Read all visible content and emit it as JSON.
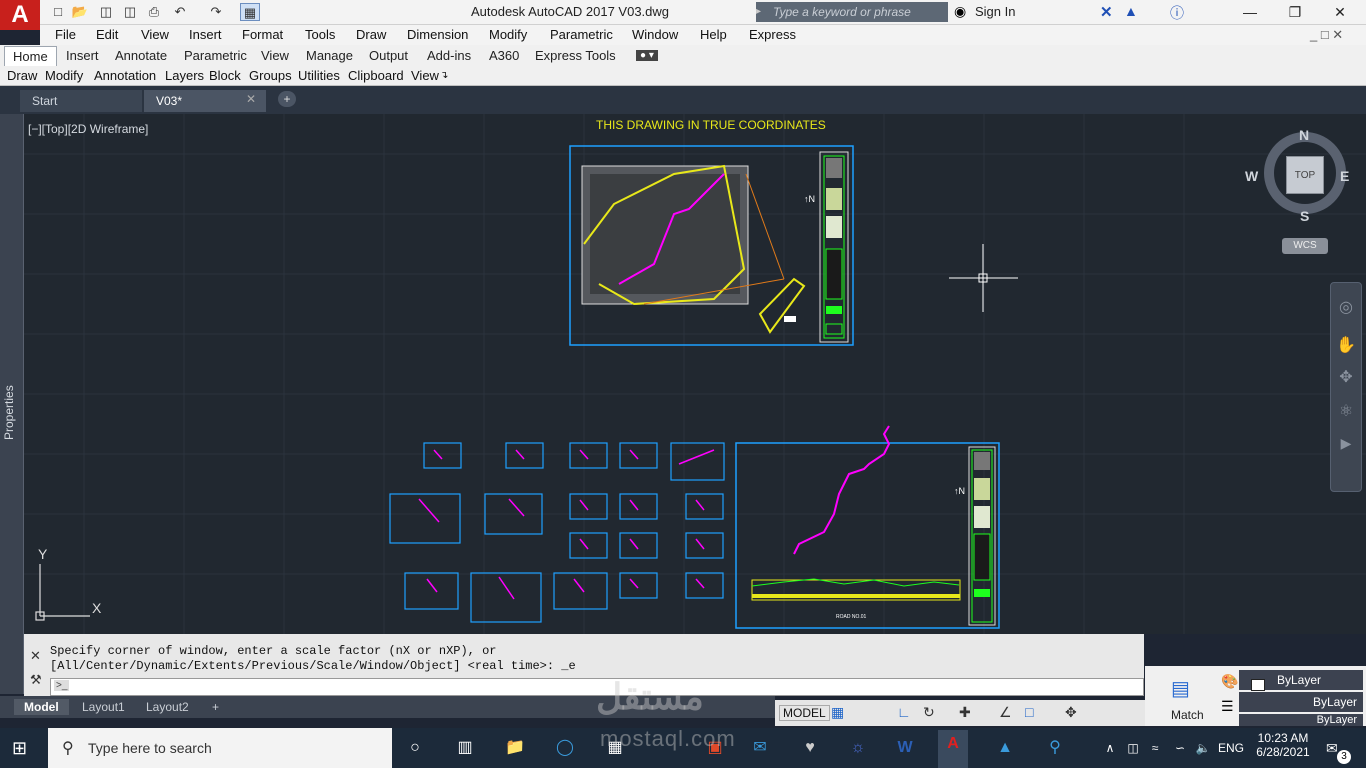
{
  "title": {
    "app_logo": "A",
    "window_title": "Autodesk AutoCAD 2017    V03.dwg",
    "search_placeholder": "Type a keyword or phrase",
    "sign_in": "Sign In"
  },
  "menu": [
    "File",
    "Edit",
    "View",
    "Insert",
    "Format",
    "Tools",
    "Draw",
    "Dimension",
    "Modify",
    "Parametric",
    "Window",
    "Help",
    "Express"
  ],
  "ribbon_tabs": [
    "Home",
    "Insert",
    "Annotate",
    "Parametric",
    "View",
    "Manage",
    "Output",
    "Add-ins",
    "A360",
    "Express Tools"
  ],
  "panels": [
    "Draw",
    "Modify",
    "Annotation",
    "Layers",
    "Block",
    "Groups",
    "Utilities",
    "Clipboard",
    "View"
  ],
  "doc_tabs": [
    "Start",
    "V03*"
  ],
  "viewport": {
    "view_label": "[−][Top][2D Wireframe]",
    "coord_note": "THIS DRAWING IN TRUE COORDINATES",
    "properties": "Properties",
    "road_label": "ROAD NO.01"
  },
  "viewcube": {
    "n": "N",
    "s": "S",
    "e": "E",
    "w": "W",
    "top": "TOP",
    "wcs": "WCS"
  },
  "ucs": {
    "x": "X",
    "y": "Y"
  },
  "command": {
    "line1": "Specify corner of window, enter a scale factor (nX or nXP), or",
    "line2": "[All/Center/Dynamic/Extents/Previous/Scale/Window/Object] <real time>: _e",
    "prompt_icon": ">_"
  },
  "layout_tabs": [
    "Model",
    "Layout1",
    "Layout2"
  ],
  "status": {
    "model": "MODEL"
  },
  "properties_panel": {
    "match": "Match",
    "bylayer1": "ByLayer",
    "bylayer2": "ByLayer",
    "bylayer3": "ByLayer"
  },
  "taskbar": {
    "search_placeholder": "Type here to search",
    "time": "10:23 AM",
    "date": "6/28/2021",
    "lang": "ENG",
    "notif_count": "3"
  },
  "watermark": {
    "arabic": "مستقل",
    "latin": "mostaql.com"
  }
}
